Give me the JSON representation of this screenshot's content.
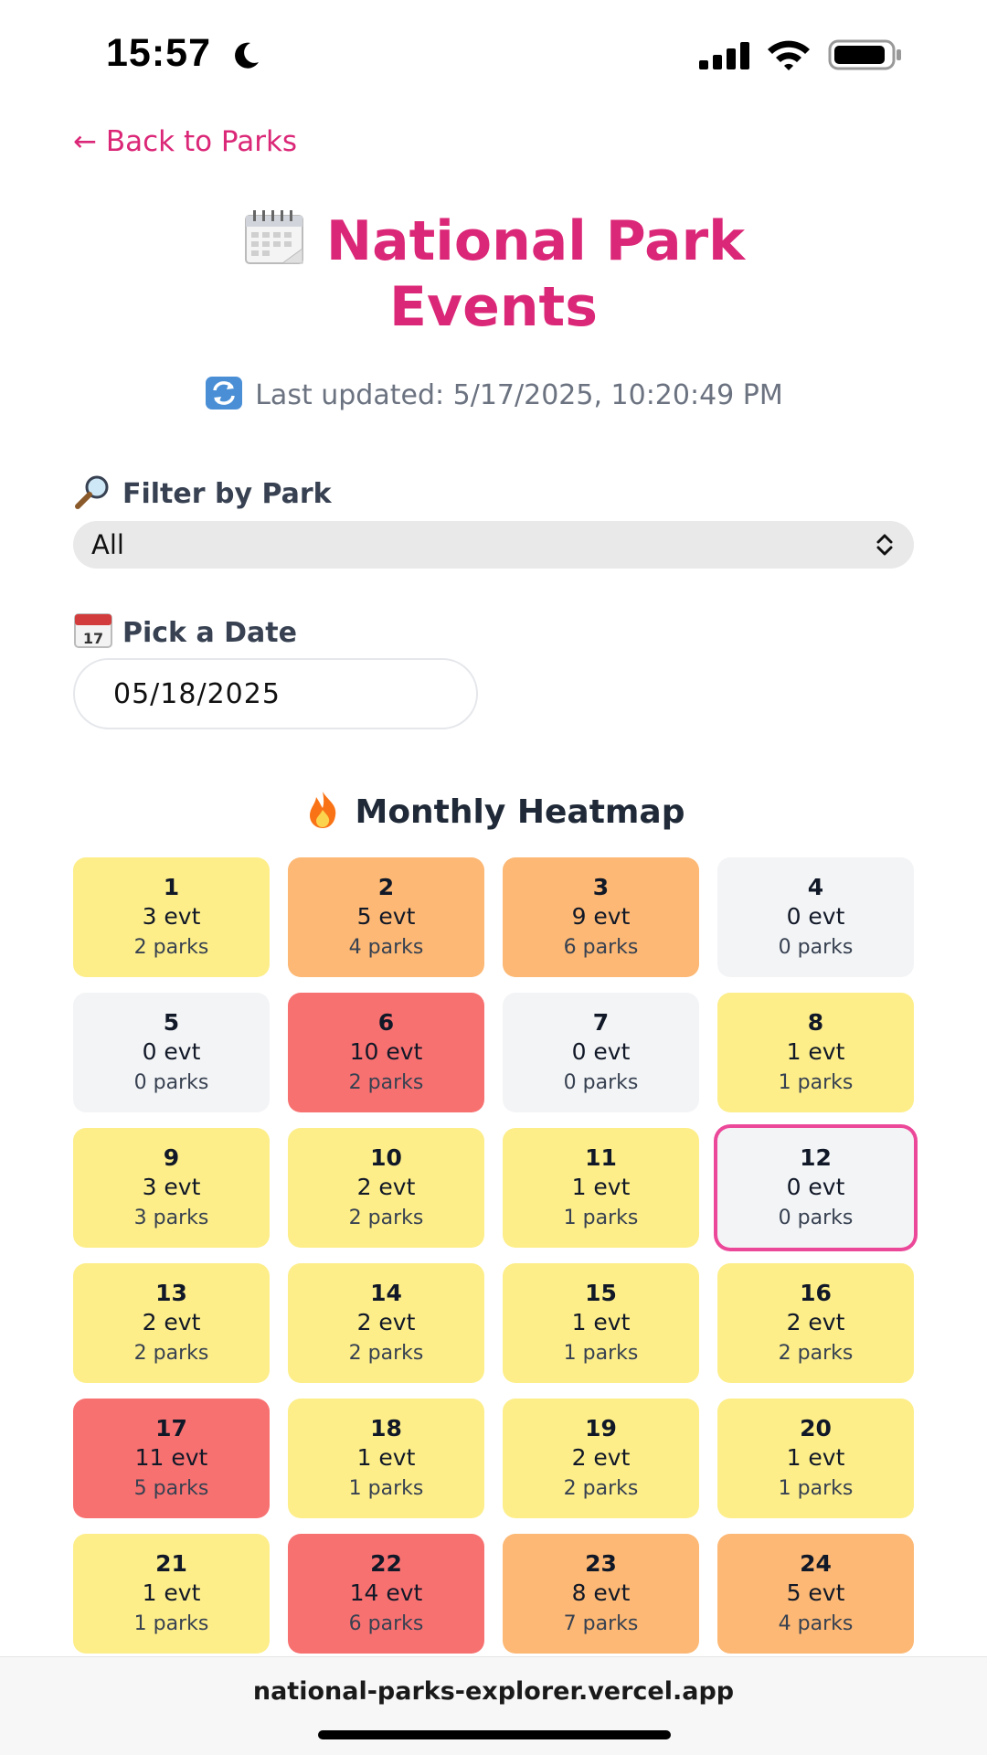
{
  "status_bar": {
    "time": "15:57"
  },
  "nav": {
    "back_label": "← Back to Parks"
  },
  "header": {
    "title_line1": "National Park",
    "title_line2": "Events",
    "title_icon": "calendar-icon",
    "last_updated": "Last updated: 5/17/2025, 10:20:49 PM"
  },
  "filter": {
    "label": "Filter by Park",
    "selected_value": "All"
  },
  "date_picker": {
    "label": "Pick a Date",
    "value": "05/18/2025"
  },
  "heatmap": {
    "title": "Monthly Heatmap",
    "colors": {
      "none": "#f3f4f6",
      "low": "#fdee8a",
      "medium": "#fcb874",
      "high": "#f87171",
      "selected_border": "#ec4899"
    },
    "days": [
      {
        "day": "1",
        "events": "3 evt",
        "parks": "2 parks",
        "level": "low"
      },
      {
        "day": "2",
        "events": "5 evt",
        "parks": "4 parks",
        "level": "medium"
      },
      {
        "day": "3",
        "events": "9 evt",
        "parks": "6 parks",
        "level": "medium"
      },
      {
        "day": "4",
        "events": "0 evt",
        "parks": "0 parks",
        "level": "none"
      },
      {
        "day": "5",
        "events": "0 evt",
        "parks": "0 parks",
        "level": "none"
      },
      {
        "day": "6",
        "events": "10 evt",
        "parks": "2 parks",
        "level": "high"
      },
      {
        "day": "7",
        "events": "0 evt",
        "parks": "0 parks",
        "level": "none"
      },
      {
        "day": "8",
        "events": "1 evt",
        "parks": "1 parks",
        "level": "low"
      },
      {
        "day": "9",
        "events": "3 evt",
        "parks": "3 parks",
        "level": "low"
      },
      {
        "day": "10",
        "events": "2 evt",
        "parks": "2 parks",
        "level": "low"
      },
      {
        "day": "11",
        "events": "1 evt",
        "parks": "1 parks",
        "level": "low"
      },
      {
        "day": "12",
        "events": "0 evt",
        "parks": "0 parks",
        "level": "none",
        "selected": true
      },
      {
        "day": "13",
        "events": "2 evt",
        "parks": "2 parks",
        "level": "low"
      },
      {
        "day": "14",
        "events": "2 evt",
        "parks": "2 parks",
        "level": "low"
      },
      {
        "day": "15",
        "events": "1 evt",
        "parks": "1 parks",
        "level": "low"
      },
      {
        "day": "16",
        "events": "2 evt",
        "parks": "2 parks",
        "level": "low"
      },
      {
        "day": "17",
        "events": "11 evt",
        "parks": "5 parks",
        "level": "high"
      },
      {
        "day": "18",
        "events": "1 evt",
        "parks": "1 parks",
        "level": "low"
      },
      {
        "day": "19",
        "events": "2 evt",
        "parks": "2 parks",
        "level": "low"
      },
      {
        "day": "20",
        "events": "1 evt",
        "parks": "1 parks",
        "level": "low"
      },
      {
        "day": "21",
        "events": "1 evt",
        "parks": "1 parks",
        "level": "low"
      },
      {
        "day": "22",
        "events": "14 evt",
        "parks": "6 parks",
        "level": "high"
      },
      {
        "day": "23",
        "events": "8 evt",
        "parks": "7 parks",
        "level": "medium"
      },
      {
        "day": "24",
        "events": "5 evt",
        "parks": "4 parks",
        "level": "medium"
      }
    ]
  },
  "browser": {
    "url": "national-parks-explorer.vercel.app"
  }
}
